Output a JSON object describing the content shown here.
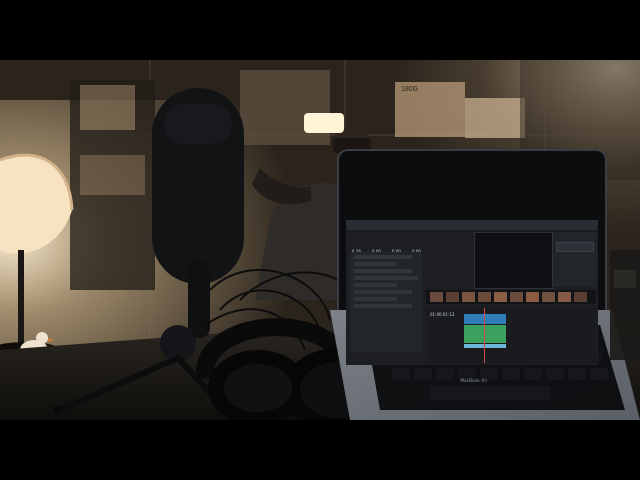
{
  "scene": {
    "description_tags": [
      "room",
      "desk",
      "mirror-reflection",
      "microphone",
      "headphones",
      "laptop",
      "desk-lamp"
    ],
    "colors": {
      "warm_light": "#f6d7a6",
      "shadow": "#17130f",
      "mirror_tint": "#3a3126",
      "laptop_body": "#6f747a",
      "keyboard": "#0b0c0e"
    }
  },
  "laptop": {
    "brand_text": "MacBook Air",
    "editor_stats": [
      "6.26",
      "6.00",
      "6.00",
      "0.00"
    ],
    "timeline_timecode": "01:00:01:13"
  },
  "labels": {
    "box_label": "180G"
  }
}
